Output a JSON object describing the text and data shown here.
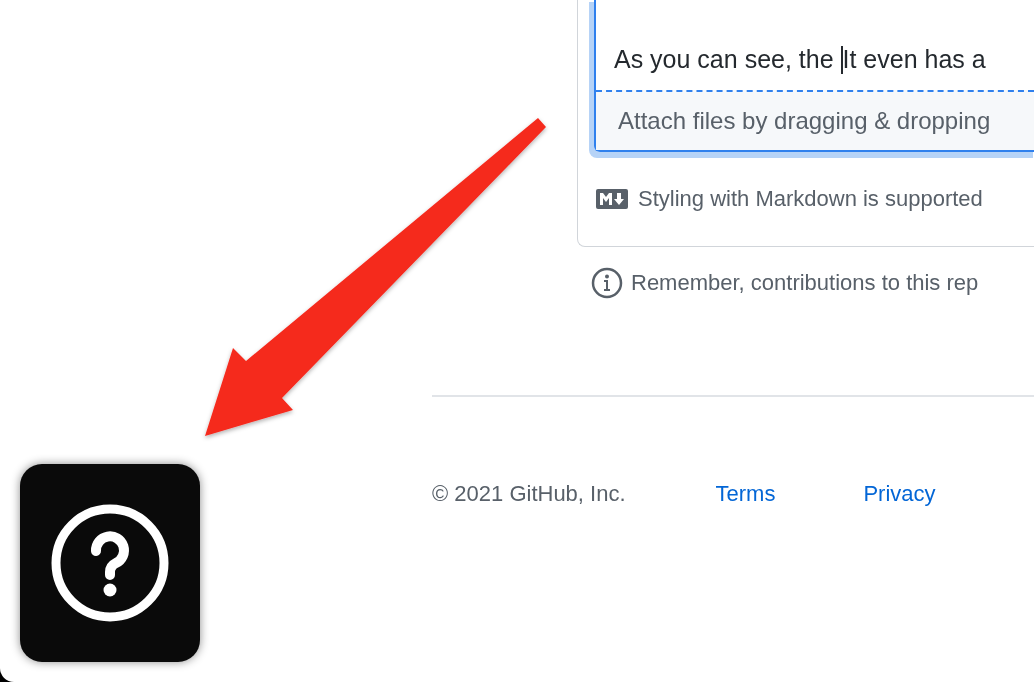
{
  "editor": {
    "value_before_caret": "As you can see, the ",
    "value_after_caret": "It even has a",
    "attach_hint": "Attach files by dragging & dropping"
  },
  "markdown_note": "Styling with Markdown is supported",
  "contribution_note": "Remember, contributions to this rep",
  "footer": {
    "copyright": "© 2021 GitHub, Inc.",
    "links": [
      "Terms",
      "Privacy"
    ]
  }
}
